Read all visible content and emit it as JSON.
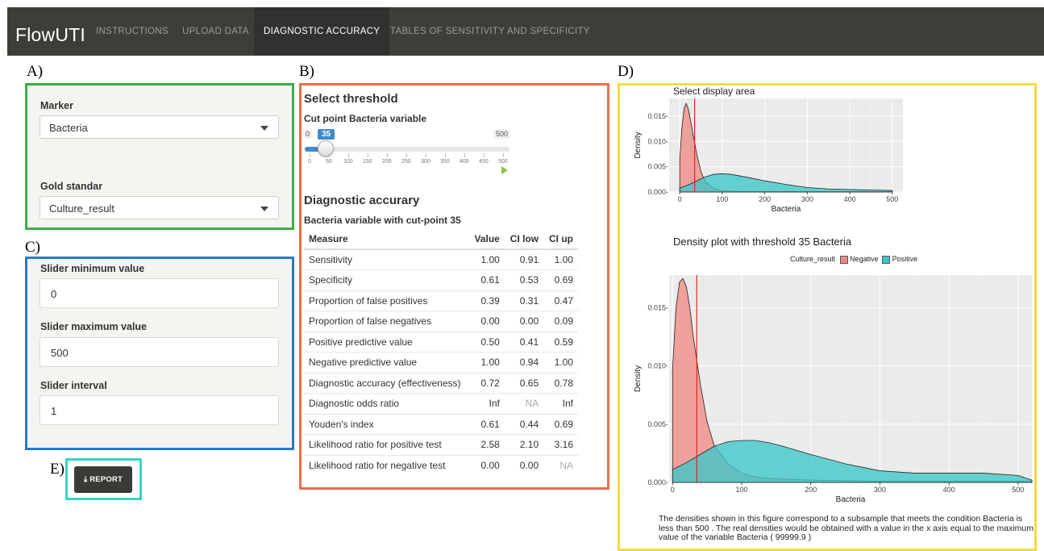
{
  "app": {
    "brand": "FlowUTI",
    "nav": [
      "INSTRUCTIONS",
      "UPLOAD DATA",
      "DIAGNOSTIC ACCURACY",
      "TABLES OF SENSITIVITY AND SPECIFICITY"
    ],
    "active_tab": "DIAGNOSTIC ACCURACY"
  },
  "labels": {
    "a": "A)",
    "b": "B)",
    "c": "C)",
    "d": "D)",
    "e": "E)"
  },
  "panel_a": {
    "marker_label": "Marker",
    "marker_value": "Bacteria",
    "gold_label": "Gold standar",
    "gold_value": "Culture_result"
  },
  "panel_c": {
    "min_label": "Slider minimum value",
    "min_value": "0",
    "max_label": "Slider maximum value",
    "max_value": "500",
    "interval_label": "Slider interval",
    "interval_value": "1"
  },
  "panel_b": {
    "threshold_title": "Select threshold",
    "slider_label": "Cut point Bacteria variable",
    "slider_min": "0",
    "slider_max": "500",
    "slider_value": "35",
    "slider_fraction": 0.07,
    "ticks": [
      "0",
      "50",
      "100",
      "150",
      "200",
      "250",
      "300",
      "350",
      "400",
      "450",
      "500"
    ],
    "accuracy_title": "Diagnostic accurary",
    "table_subtitle": "Bacteria variable with cut-point 35",
    "table": {
      "headers": [
        "Measure",
        "Value",
        "CI low",
        "CI up"
      ],
      "rows": [
        [
          "Sensitivity",
          "1.00",
          "0.91",
          "1.00"
        ],
        [
          "Specificity",
          "0.61",
          "0.53",
          "0.69"
        ],
        [
          "Proportion of false positives",
          "0.39",
          "0.31",
          "0.47"
        ],
        [
          "Proportion of false negatives",
          "0.00",
          "0.00",
          "0.09"
        ],
        [
          "Positive predictive value",
          "0.50",
          "0.41",
          "0.59"
        ],
        [
          "Negative predictive value",
          "1.00",
          "0.94",
          "1.00"
        ],
        [
          "Diagnostic accuracy (effectiveness)",
          "0.72",
          "0.65",
          "0.78"
        ],
        [
          "Diagnostic odds ratio",
          "Inf",
          "NA",
          "Inf"
        ],
        [
          "Youden's index",
          "0.61",
          "0.44",
          "0.69"
        ],
        [
          "Likelihood ratio for positive test",
          "2.58",
          "2.10",
          "3.16"
        ],
        [
          "Likelihood ratio for negative test",
          "0.00",
          "0.00",
          "NA"
        ]
      ]
    }
  },
  "report_button": {
    "label": "REPORT",
    "icon": "download-icon"
  },
  "colors": {
    "negative": "#f08a84",
    "positive": "#3cc6c9",
    "threshold": "#e0261d",
    "panel_bg": "#ebebeb"
  },
  "chart_data": [
    {
      "type": "area",
      "title": "Select display area",
      "xlabel": "Bacteria",
      "ylabel": "Density",
      "xlim": [
        -25,
        525
      ],
      "ylim": [
        0,
        0.0185
      ],
      "xticks": [
        0,
        100,
        200,
        300,
        400,
        500
      ],
      "yticks": [
        0,
        0.005,
        0.01,
        0.015
      ],
      "ytick_labels": [
        "0.000-",
        "0.005-",
        "0.010-",
        "0.015-"
      ],
      "threshold": 35,
      "series": [
        {
          "name": "Negative",
          "x": [
            0,
            5,
            10,
            15,
            20,
            30,
            40,
            50,
            60,
            80,
            100,
            130,
            160,
            200,
            250,
            300,
            350,
            400,
            450,
            500
          ],
          "values": [
            0.0065,
            0.0125,
            0.0165,
            0.0175,
            0.0165,
            0.012,
            0.0075,
            0.004,
            0.002,
            0.0007,
            0.0003,
            0.0001,
            0.0001,
            0.0001,
            0.0001,
            0.0001,
            0.0001,
            0.0001,
            0.0001,
            0.0001
          ]
        },
        {
          "name": "Positive",
          "x": [
            0,
            20,
            40,
            60,
            80,
            100,
            120,
            140,
            160,
            200,
            250,
            300,
            350,
            400,
            450,
            500
          ],
          "values": [
            0.0008,
            0.0014,
            0.0022,
            0.003,
            0.0035,
            0.0036,
            0.0035,
            0.0032,
            0.0029,
            0.0022,
            0.0015,
            0.0009,
            0.0006,
            0.0005,
            0.0004,
            0.0003
          ]
        }
      ]
    },
    {
      "type": "area",
      "title": "Density plot with threshold  35 Bacteria",
      "legend_title": "Culture_result",
      "legend": [
        "Negative",
        "Positive"
      ],
      "legend_position": "top",
      "xlabel": "Bacteria",
      "ylabel": "Density",
      "xlim": [
        -5,
        520
      ],
      "ylim": [
        0,
        0.0178
      ],
      "xticks": [
        0,
        100,
        200,
        300,
        400,
        500
      ],
      "yticks": [
        0,
        0.005,
        0.01,
        0.015
      ],
      "ytick_labels": [
        "0.000-",
        "0.005-",
        "0.010-",
        "0.015-"
      ],
      "threshold": 35,
      "series": [
        {
          "name": "Negative",
          "x": [
            0,
            5,
            10,
            15,
            20,
            25,
            30,
            40,
            50,
            60,
            70,
            80,
            90,
            100,
            110,
            130,
            150,
            200,
            300,
            400,
            520
          ],
          "values": [
            0.0098,
            0.015,
            0.0172,
            0.0175,
            0.0168,
            0.015,
            0.0125,
            0.0085,
            0.0052,
            0.0032,
            0.0024,
            0.0016,
            0.0012,
            0.0008,
            0.0006,
            0.0004,
            0.0003,
            0.0002,
            0.0001,
            0.0001,
            0.0001
          ]
        },
        {
          "name": "Positive",
          "x": [
            0,
            20,
            40,
            60,
            80,
            100,
            120,
            140,
            160,
            200,
            250,
            300,
            350,
            400,
            450,
            500,
            520
          ],
          "values": [
            0.0011,
            0.0017,
            0.0024,
            0.0031,
            0.0035,
            0.0036,
            0.0036,
            0.0034,
            0.0031,
            0.0024,
            0.0016,
            0.001,
            0.0008,
            0.0008,
            0.0008,
            0.0006,
            0.0002
          ]
        }
      ]
    }
  ],
  "footnote": "The densities shown in this figure correspond to a subsample that meets the condition Bacteria is less than 500 . The real densities would be obtained with a value in the x axis equal to the maximum value of the variable Bacteria ( 99999.9 )"
}
